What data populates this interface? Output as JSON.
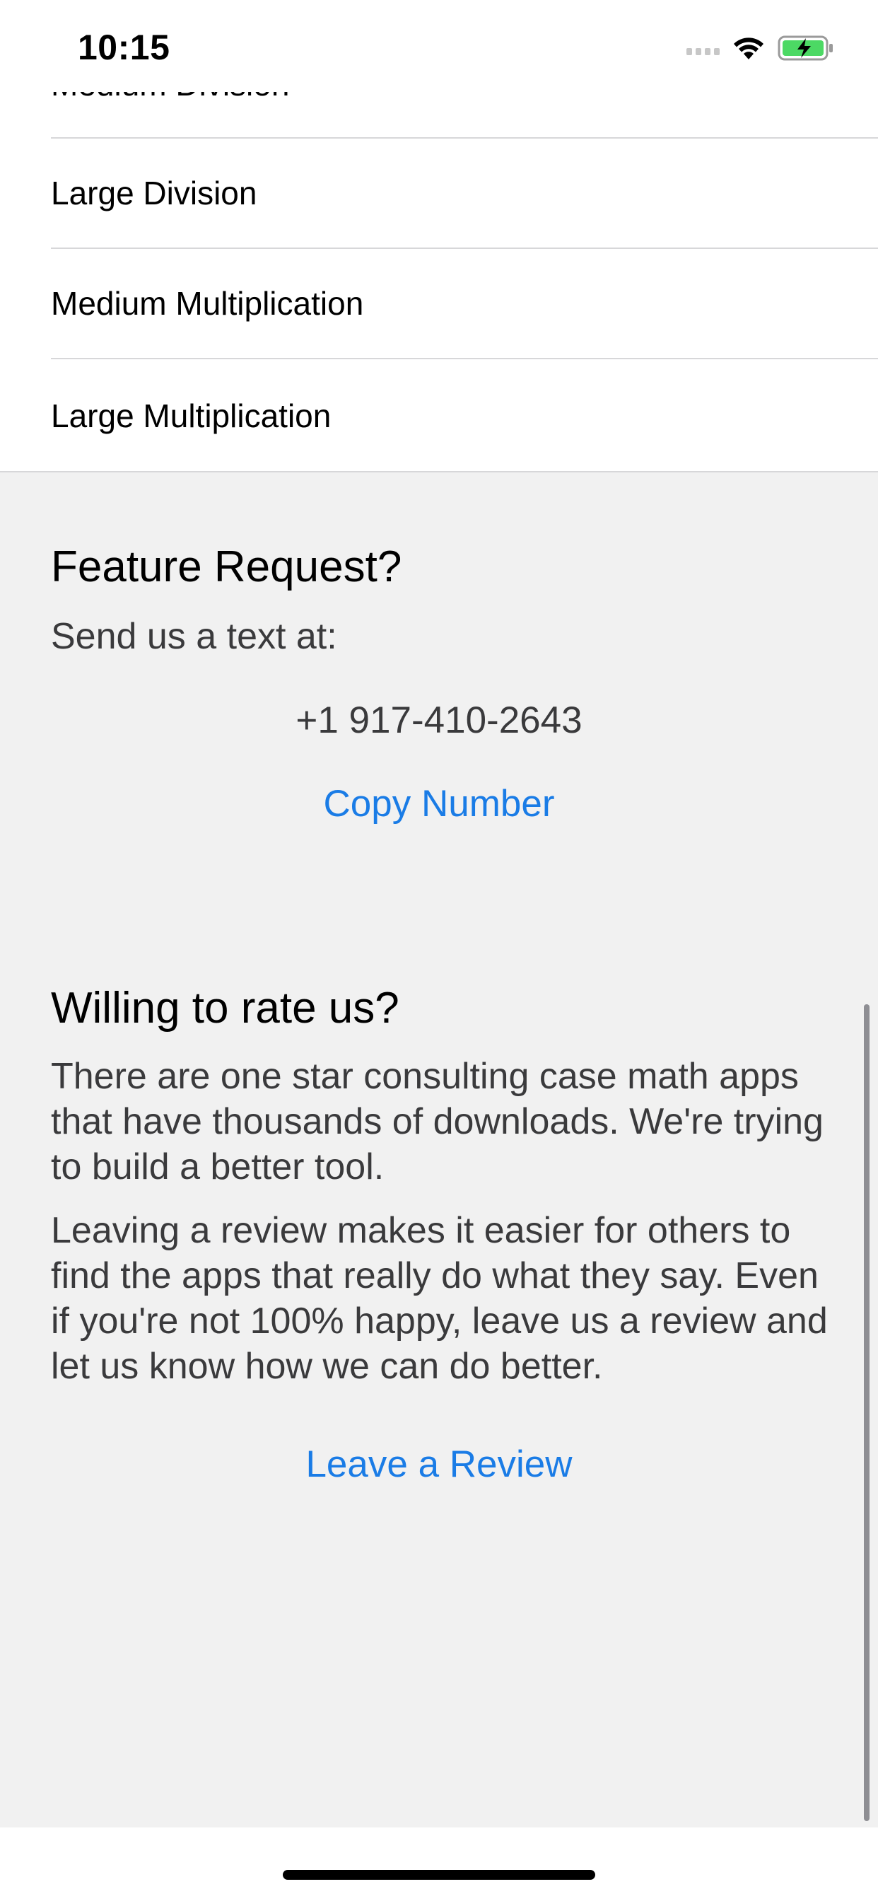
{
  "status_bar": {
    "time": "10:15"
  },
  "list": {
    "items": [
      {
        "label": "Medium Division"
      },
      {
        "label": "Large Division"
      },
      {
        "label": "Medium Multiplication"
      },
      {
        "label": "Large Multiplication"
      }
    ]
  },
  "feature_request": {
    "title": "Feature Request?",
    "subtitle": "Send us a text at:",
    "phone": "+1 917-410-2643",
    "copy_button": "Copy Number"
  },
  "rate": {
    "title": "Willing to rate us?",
    "paragraph1": "There are one star consulting case math apps that have thousands of downloads. We're trying to build a better tool.",
    "paragraph2": "Leaving a review makes it easier for others to find the apps that really do what they say. Even if you're not 100% happy, leave us a review and let us know how we can do better.",
    "review_button": "Leave a Review"
  },
  "icons": [
    "cellular-signal-icon",
    "wifi-icon",
    "battery-charging-icon"
  ],
  "colors": {
    "background": "#f1f1f1",
    "list_background": "#ffffff",
    "accent": "#1a7ce6",
    "battery_green": "#4cd964"
  }
}
